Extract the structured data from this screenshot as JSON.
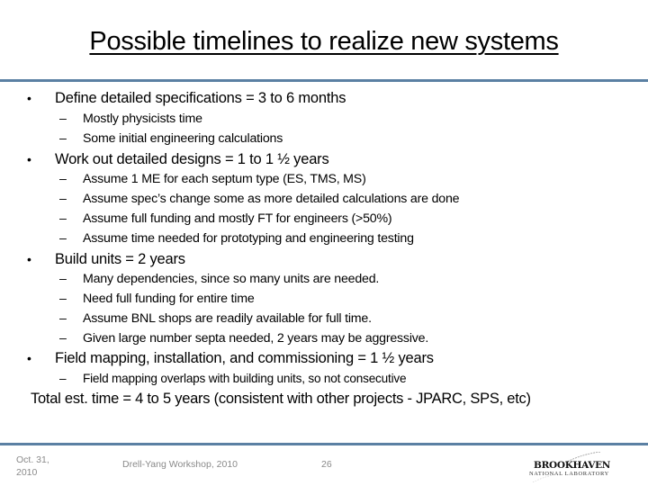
{
  "slide": {
    "title": "Possible timelines to realize new systems",
    "bullets": [
      {
        "text": "Define detailed specifications = 3 to 6 months",
        "subitems": [
          "Mostly physicists time",
          "Some initial engineering calculations"
        ]
      },
      {
        "text": "Work out detailed designs = 1 to 1 ½ years",
        "subitems": [
          "Assume 1 ME for each septum type (ES, TMS, MS)",
          "Assume spec’s change some as more detailed calculations are done",
          "Assume full funding and mostly FT for engineers (>50%)",
          "Assume time needed for prototyping and engineering testing"
        ]
      },
      {
        "text": "Build units = 2 years",
        "subitems": [
          "Many dependencies, since so many units are needed.",
          "Need full funding for entire time",
          "Assume BNL shops are readily available for full time.",
          "Given large number septa needed, 2 years may be aggressive."
        ]
      },
      {
        "text": "Field mapping, installation, and commissioning = 1 ½ years",
        "subitems": [
          "Field mapping overlaps with building units, so not consecutive"
        ]
      }
    ],
    "total": "Total est. time = 4 to 5 years (consistent with other projects  - JPARC, SPS, etc)",
    "bullet_glyph": "•",
    "dash_glyph": "–"
  },
  "footer": {
    "date_line1": "Oct. 31,",
    "date_line2": "2010",
    "event": "Drell-Yang Workshop, 2010",
    "page_number": "26",
    "logo_main": "BROOKHAVEN",
    "logo_sub": "NATIONAL LABORATORY"
  },
  "colors": {
    "divider": "#5b80a3",
    "footer_text": "#8a8a8a"
  }
}
